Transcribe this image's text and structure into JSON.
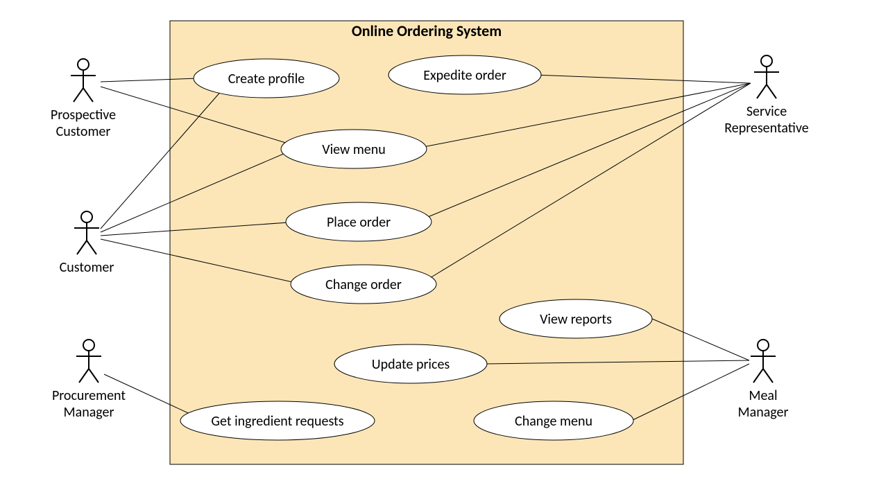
{
  "diagram": {
    "system_title": "Online Ordering System",
    "actors": {
      "prospective_customer_l1": "Prospective",
      "prospective_customer_l2": "Customer",
      "customer": "Customer",
      "procurement_l1": "Procurement",
      "procurement_l2": "Manager",
      "service_rep_l1": "Service",
      "service_rep_l2": "Representative",
      "meal_manager_l1": "Meal",
      "meal_manager_l2": "Manager"
    },
    "usecases": {
      "create_profile": "Create profile",
      "expedite_order": "Expedite order",
      "view_menu": "View menu",
      "place_order": "Place order",
      "change_order": "Change order",
      "view_reports": "View reports",
      "update_prices": "Update prices",
      "get_ingredient_requests": "Get ingredient requests",
      "change_menu": "Change menu"
    }
  }
}
